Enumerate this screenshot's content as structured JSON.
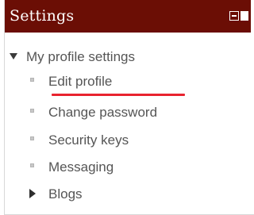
{
  "block": {
    "title": "Settings",
    "dock_icon": "dock-block-icon"
  },
  "tree": {
    "root_label": "My profile settings",
    "root_icon": "collapse-triangle-icon",
    "items": [
      {
        "label": "Edit profile",
        "icon": "bullet-icon"
      },
      {
        "label": "Change password",
        "icon": "bullet-icon"
      },
      {
        "label": "Security keys",
        "icon": "bullet-icon"
      },
      {
        "label": "Messaging",
        "icon": "bullet-icon"
      }
    ],
    "collapsed_item": {
      "label": "Blogs",
      "icon": "expand-triangle-icon"
    }
  },
  "colors": {
    "header_bg": "#6b0e05",
    "header_text": "#ffffff",
    "link_text": "#555555",
    "highlight_underline": "#e8232f"
  }
}
